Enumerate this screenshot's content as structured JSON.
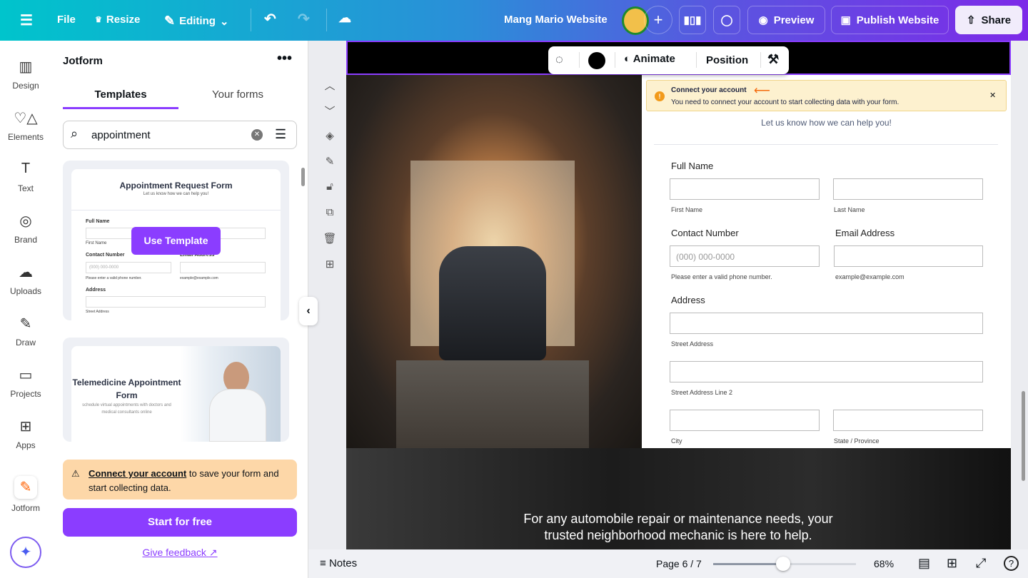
{
  "topbar": {
    "file": "File",
    "resize": "Resize",
    "editing": "Editing",
    "title": "Mang Mario Website",
    "preview": "Preview",
    "publish": "Publish Website",
    "share": "Share"
  },
  "rail": [
    {
      "label": "Design",
      "icon": "▥"
    },
    {
      "label": "Elements",
      "icon": "♡△"
    },
    {
      "label": "Text",
      "icon": "T"
    },
    {
      "label": "Brand",
      "icon": "◎"
    },
    {
      "label": "Uploads",
      "icon": "☁"
    },
    {
      "label": "Draw",
      "icon": "✎"
    },
    {
      "label": "Projects",
      "icon": "▭"
    },
    {
      "label": "Apps",
      "icon": "⊞"
    },
    {
      "label": "Jotform",
      "icon": "✎"
    }
  ],
  "panel": {
    "title": "Jotform",
    "tabs": [
      "Templates",
      "Your forms"
    ],
    "search_value": "appointment",
    "card1": {
      "title": "Appointment Request Form",
      "subtitle": "Let us know how we can help you!",
      "full_name": "Full Name",
      "first_name": "First Name",
      "contact": "Contact Number",
      "email": "Email Address",
      "phone_ph": "(000) 000-0000",
      "phone_hint": "Please enter a valid phone number.",
      "email_hint": "example@example.com",
      "address": "Address",
      "street": "Street Address",
      "button": "Use Template"
    },
    "card2": {
      "title": "Telemedicine Appointment Form",
      "subtitle": "schedule virtual appointments with doctors and medical consultants online"
    },
    "notice_link": "Connect your account",
    "notice_text": " to save your form and start collecting data.",
    "start": "Start for free",
    "feedback": "Give feedback"
  },
  "context": {
    "animate": "Animate",
    "position": "Position",
    "color": "#000000"
  },
  "form": {
    "alert_title": "Connect your account",
    "alert_text": "You need to connect your account to start collecting data with your form.",
    "subtitle": "Let us know how we can help you!",
    "full_name": "Full Name",
    "first_name": "First Name",
    "last_name": "Last Name",
    "contact": "Contact Number",
    "email": "Email Address",
    "phone_ph": "(000) 000-0000",
    "phone_hint": "Please enter a valid phone number.",
    "email_hint": "example@example.com",
    "address": "Address",
    "street": "Street Address",
    "street2": "Street Address Line 2",
    "city": "City",
    "state": "State / Province"
  },
  "band_text": "For any automobile repair or maintenance needs, your trusted neighborhood mechanic is here to help.",
  "bottom": {
    "notes": "Notes",
    "page": "Page 6 / 7",
    "zoom": "68%",
    "zoom_value": 68
  }
}
